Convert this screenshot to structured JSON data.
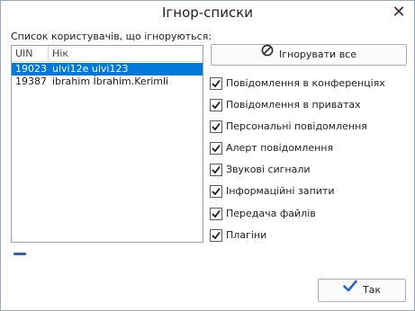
{
  "window": {
    "title": "Ігнор-списки"
  },
  "list": {
    "caption": "Список користувачів, що ігноруються:",
    "columns": {
      "uin": "UIN",
      "nick": "Нік"
    },
    "rows": [
      {
        "uin": "19023",
        "nick": "ulvi12e ulvi123",
        "selected": true
      },
      {
        "uin": "19387",
        "nick": "ibrahim İbrahim.Kerimli",
        "selected": false
      }
    ]
  },
  "buttons": {
    "ignore_all": "Ігнорувати все",
    "ok": "Так"
  },
  "options": [
    {
      "label": "Повідомлення в конференціях",
      "checked": true
    },
    {
      "label": "Повідомлення в приватах",
      "checked": true
    },
    {
      "label": "Персональні повідомлення",
      "checked": true
    },
    {
      "label": "Алерт повідомлення",
      "checked": true
    },
    {
      "label": "Звукові сигнали",
      "checked": true
    },
    {
      "label": "Інформаційні запити",
      "checked": true
    },
    {
      "label": "Передача файлів",
      "checked": true
    },
    {
      "label": "Плагіни",
      "checked": true
    }
  ],
  "colors": {
    "selection": "#0078d7",
    "accent": "#2a64c4"
  }
}
